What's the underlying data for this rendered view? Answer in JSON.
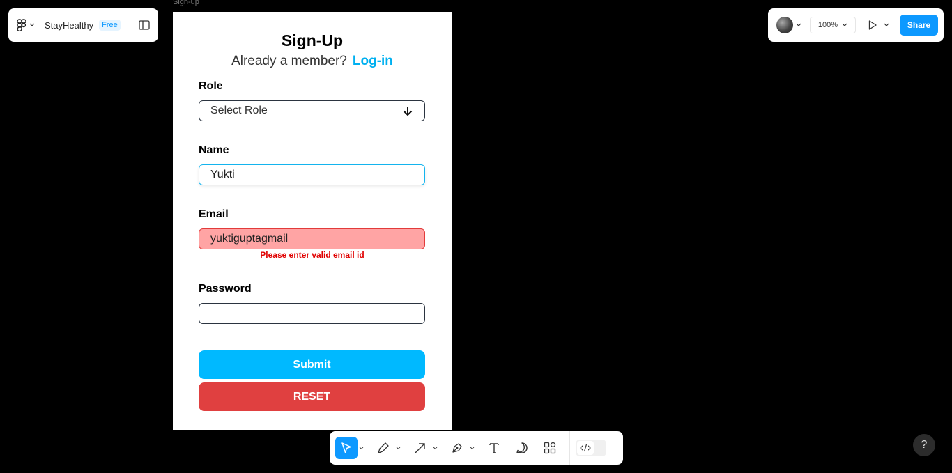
{
  "app": {
    "project_name": "StayHealthy",
    "plan_badge": "Free",
    "zoom_label": "100%",
    "share_label": "Share",
    "help_label": "?"
  },
  "frame": {
    "label": "Sign-up",
    "title": "Sign-Up",
    "subtitle_text": "Already a member?",
    "login_link": "Log-in",
    "role": {
      "label": "Role",
      "placeholder": "Select Role"
    },
    "name": {
      "label": "Name",
      "value": "Yukti"
    },
    "email": {
      "label": "Email",
      "value": "yuktiguptagmail",
      "error": "Please enter valid email id"
    },
    "password": {
      "label": "Password",
      "value": ""
    },
    "submit_label": "Submit",
    "reset_label": "RESET"
  },
  "toolbar": {
    "tools": [
      "move-tool",
      "pencil-tool",
      "arrow-tool",
      "pen-tool",
      "text-tool",
      "comment-tool",
      "widgets-tool",
      "dev-mode-toggle"
    ]
  },
  "colors": {
    "accent": "#0d99ff",
    "link": "#00b0f0",
    "submit": "#00b9ff",
    "reset": "#e04040",
    "error": "#e00000",
    "email_bg": "#ffa4a4"
  }
}
